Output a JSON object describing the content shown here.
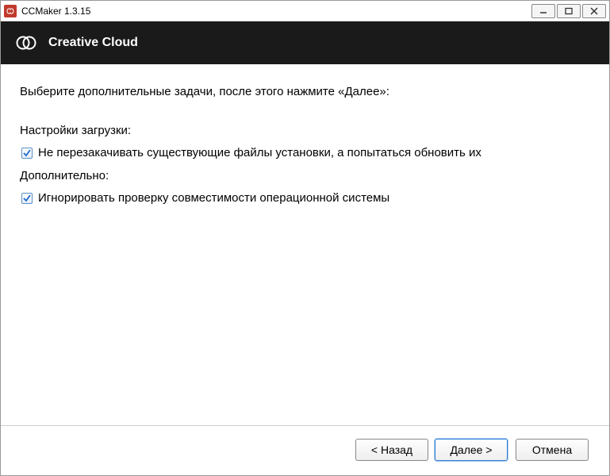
{
  "titlebar": {
    "title": "CCMaker 1.3.15"
  },
  "header": {
    "title": "Creative Cloud"
  },
  "content": {
    "intro": "Выберите дополнительные задачи, после этого нажмите «Далее»:",
    "section_download": "Настройки загрузки:",
    "checkbox_download_label": "Не перезакачивать существующие файлы установки, а попытаться обновить их",
    "section_additional": "Дополнительно:",
    "checkbox_ignore_label": "Игнорировать проверку совместимости операционной системы"
  },
  "footer": {
    "back": "< Назад",
    "next": "Далее >",
    "cancel": "Отмена"
  }
}
